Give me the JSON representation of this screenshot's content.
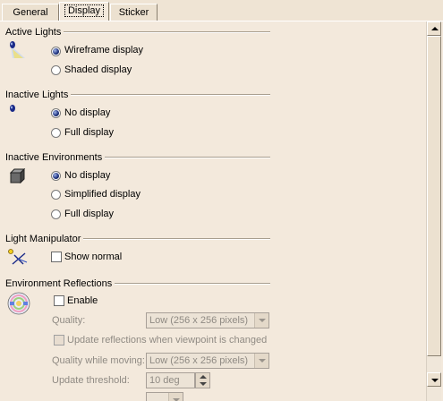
{
  "tabs": [
    "General",
    "Display",
    "Sticker"
  ],
  "sections": {
    "active_lights": {
      "title": "Active Lights",
      "icon": "active-light-icon",
      "options": [
        "Wireframe display",
        "Shaded display"
      ],
      "selected": "Wireframe display"
    },
    "inactive_lights": {
      "title": "Inactive Lights",
      "icon": "inactive-light-icon",
      "options": [
        "No display",
        "Full display"
      ],
      "selected": "No display"
    },
    "inactive_environments": {
      "title": "Inactive Environments",
      "icon": "environment-cube-icon",
      "options": [
        "No display",
        "Simplified display",
        "Full display"
      ],
      "selected": "No display"
    },
    "light_manipulator": {
      "title": "Light Manipulator",
      "icon": "light-manipulator-icon",
      "checkbox": "Show normal",
      "checked": false
    },
    "environment_reflections": {
      "title": "Environment Reflections",
      "icon": "reflection-sphere-icon",
      "enable_label": "Enable",
      "enabled": false,
      "quality_label": "Quality:",
      "quality_value": "Low (256 x 256 pixels)",
      "update_label": "Update reflections when viewpoint is changed",
      "quality_moving_label": "Quality while moving:",
      "quality_moving_value": "Low (256 x 256 pixels)",
      "threshold_label": "Update threshold:",
      "threshold_value": "10 deg"
    }
  },
  "colors": {
    "background": "#f3e9dc",
    "separator": "#a89e8e",
    "disabled_text": "#8f8a83"
  }
}
